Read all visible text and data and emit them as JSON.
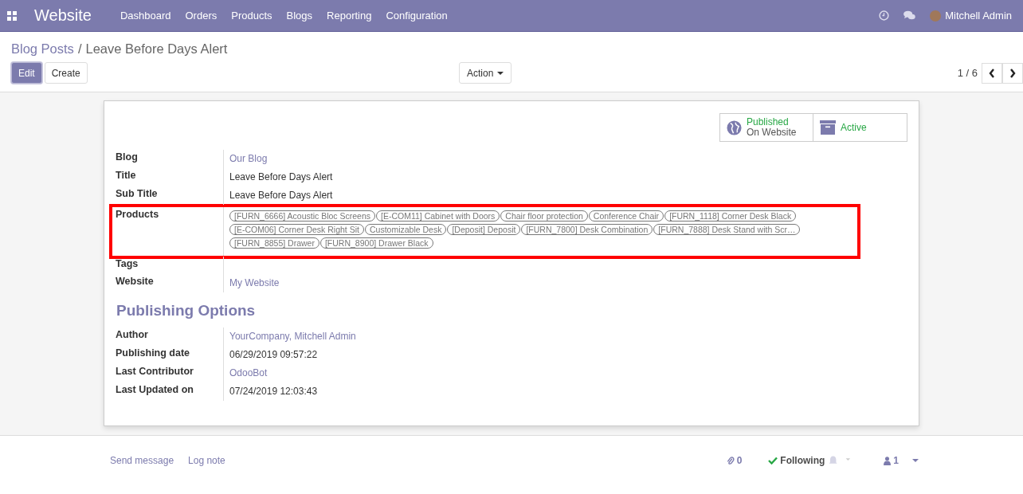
{
  "navbar": {
    "app": "Website",
    "menu": [
      "Dashboard",
      "Orders",
      "Products",
      "Blogs",
      "Reporting",
      "Configuration"
    ],
    "user": "Mitchell Admin"
  },
  "breadcrumb": {
    "parent": "Blog Posts",
    "separator": "/",
    "current": "Leave Before Days Alert"
  },
  "buttons": {
    "edit": "Edit",
    "create": "Create",
    "action": "Action"
  },
  "pager": "1 / 6",
  "smart_buttons": [
    {
      "kind": "published",
      "status": "Published",
      "label": "On Website"
    },
    {
      "kind": "active",
      "status": "Active"
    }
  ],
  "fields": [
    {
      "label": "Blog",
      "kind": "link",
      "value": "Our Blog",
      "highlighted": false
    },
    {
      "label": "Title",
      "kind": "text",
      "value": "Leave Before Days Alert",
      "highlighted": false
    },
    {
      "label": "Sub Title",
      "kind": "text",
      "value": "Leave Before Days Alert",
      "highlighted": false
    },
    {
      "label": "Products",
      "kind": "tags",
      "highlighted": true,
      "tags": [
        "[FURN_6666] Acoustic Bloc Screens",
        "[E-COM11] Cabinet with Doors",
        "Chair floor protection",
        "Conference Chair",
        "[FURN_1118] Corner Desk Black",
        "[E-COM06] Corner Desk Right Sit",
        "Customizable Desk",
        "[Deposit] Deposit",
        "[FURN_7800] Desk Combination",
        "[FURN_7888] Desk Stand with Scr…",
        "[FURN_8855] Drawer",
        "[FURN_8900] Drawer Black"
      ]
    },
    {
      "label": "Tags",
      "kind": "empty",
      "highlighted": false
    },
    {
      "label": "Website",
      "kind": "link",
      "value": "My Website",
      "highlighted": false
    }
  ],
  "publishing": {
    "title": "Publishing Options",
    "fields": [
      {
        "label": "Author",
        "kind": "link",
        "value": "YourCompany, Mitchell Admin"
      },
      {
        "label": "Publishing date",
        "kind": "text",
        "value": "06/29/2019 09:57:22"
      },
      {
        "label": "Last Contributor",
        "kind": "link",
        "value": "OdooBot"
      },
      {
        "label": "Last Updated on",
        "kind": "text",
        "value": "07/24/2019 12:03:43"
      }
    ]
  },
  "chatter": {
    "send": "Send message",
    "log": "Log note",
    "attachments": "0",
    "following": "Following",
    "followers": "1"
  }
}
